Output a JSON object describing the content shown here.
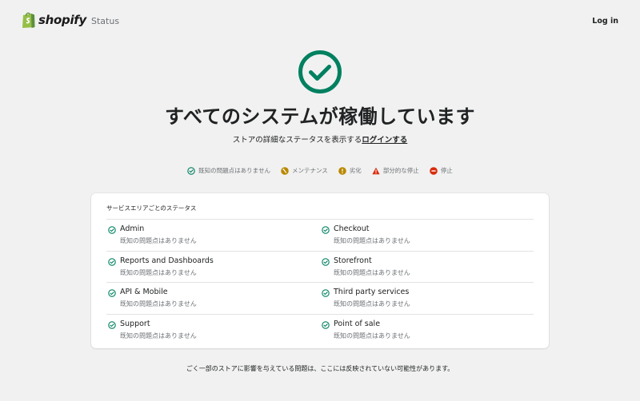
{
  "header": {
    "brand": "shopify",
    "brand_suffix": "Status",
    "login_label": "Log in"
  },
  "hero": {
    "title": "すべてのシステムが稼働しています",
    "subtitle_prefix": "ストアの詳細なステータスを表示する",
    "subtitle_link": "ログインする",
    "icon": "check-circle-icon"
  },
  "legend": [
    {
      "label": "既知の問題点はありません",
      "icon": "check-circle-icon",
      "color": "#008060"
    },
    {
      "label": "メンテナンス",
      "icon": "wrench-icon",
      "color": "#b98900"
    },
    {
      "label": "劣化",
      "icon": "degraded-icon",
      "color": "#b98900"
    },
    {
      "label": "部分的な停止",
      "icon": "warning-triangle-icon",
      "color": "#d82c0d"
    },
    {
      "label": "停止",
      "icon": "stop-icon",
      "color": "#d82c0d"
    }
  ],
  "services_card": {
    "title": "サービスエリアごとのステータス",
    "rows": [
      [
        {
          "name": "Admin",
          "status": "既知の問題点はありません"
        },
        {
          "name": "Checkout",
          "status": "既知の問題点はありません"
        }
      ],
      [
        {
          "name": "Reports and Dashboards",
          "status": "既知の問題点はありません"
        },
        {
          "name": "Storefront",
          "status": "既知の問題点はありません"
        }
      ],
      [
        {
          "name": "API & Mobile",
          "status": "既知の問題点はありません"
        },
        {
          "name": "Third party services",
          "status": "既知の問題点はありません"
        }
      ],
      [
        {
          "name": "Support",
          "status": "既知の問題点はありません"
        },
        {
          "name": "Point of sale",
          "status": "既知の問題点はありません"
        }
      ]
    ]
  },
  "footer_note": "ごく一部のストアに影響を与えている問題は、ここには反映されていない可能性があります。",
  "colors": {
    "ok_green": "#008060",
    "background": "#f1f1f1",
    "card": "#ffffff"
  }
}
